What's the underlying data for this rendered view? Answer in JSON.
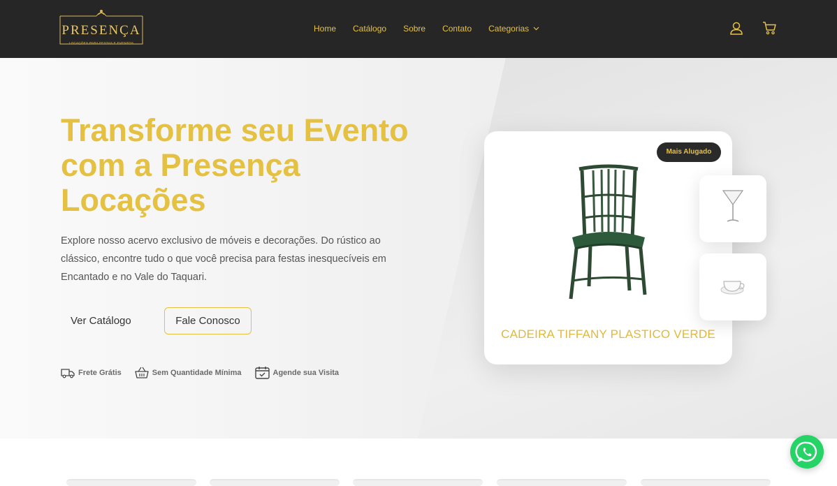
{
  "brand": {
    "logo_text": "PRESENÇA",
    "logo_sub": "LOCAÇÕES PARA FESTAS E EVENTOS"
  },
  "nav": [
    {
      "label": "Home"
    },
    {
      "label": "Catálogo"
    },
    {
      "label": "Sobre"
    },
    {
      "label": "Contato"
    },
    {
      "label": "Categorias"
    }
  ],
  "header_icons": [
    "user-icon",
    "cart-icon"
  ],
  "hero": {
    "title": "Transforme seu Evento com a Presença Locações",
    "description": "Explore nosso acervo exclusivo de móveis e decorações. Do rústico ao clássico, encontre tudo o que você precisa para festas inesquecíveis em Encantado e no Vale do Taquari.",
    "primary_button": "Ver Catálogo",
    "secondary_button": "Fale Conosco",
    "features": [
      {
        "icon": "truck-icon",
        "label": "Frete Grátis"
      },
      {
        "icon": "basket-icon",
        "label": "Sem Quantidade Mínima"
      },
      {
        "icon": "calendar-check-icon",
        "label": "Agende sua Visita"
      }
    ]
  },
  "featured_product": {
    "badge": "Mais Alugado",
    "name": "CADEIRA TIFFANY PLASTICO VERDE",
    "thumbnails": [
      "martini-glass",
      "teacup"
    ]
  },
  "colors": {
    "accent": "#e4c142",
    "header_bg": "#262626",
    "whatsapp": "#25d366"
  }
}
